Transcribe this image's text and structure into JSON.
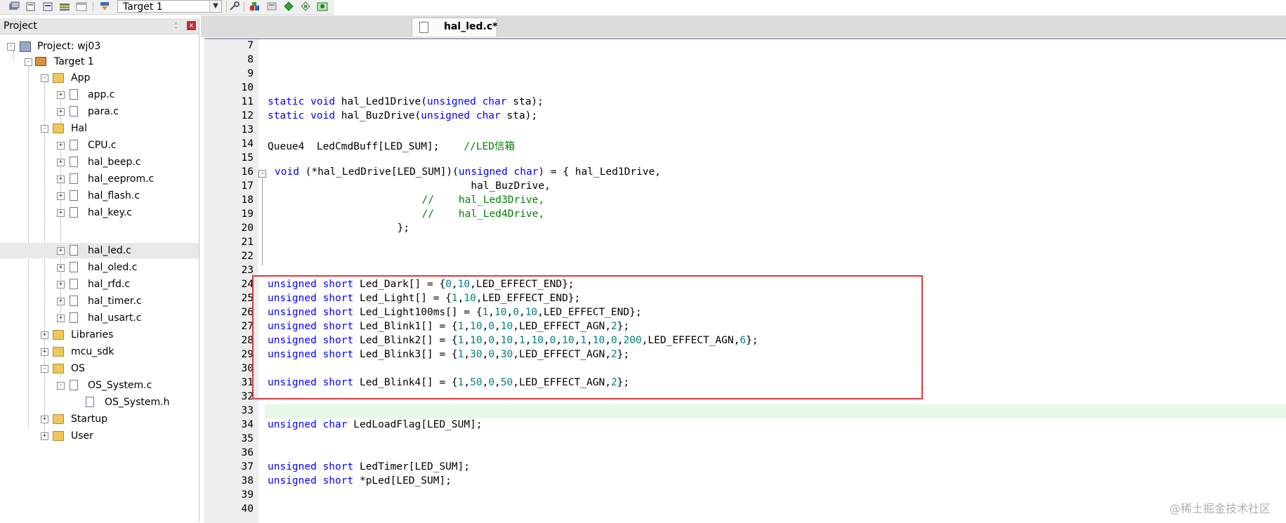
{
  "toolbar": {
    "target_select_value": "Target 1",
    "icons": [
      "batch-setup-icon",
      "copy-icon",
      "project-icon",
      "books-icon",
      "window-icon",
      "load-icon",
      "wrench-icon",
      "pack-installer-icon",
      "select-packs-icon",
      "manage-environment-icon",
      "green-diamond-icon",
      "components-icon"
    ]
  },
  "project_panel": {
    "title": "Project",
    "pin_glyph": "⍘",
    "close_glyph": "x",
    "tree": {
      "project_label": "Project: wj03",
      "target_label": "Target 1",
      "groups": {
        "app": {
          "label": "App",
          "files": [
            "app.c",
            "para.c"
          ]
        },
        "hal": {
          "label": "Hal",
          "files": [
            "CPU.c",
            "hal_beep.c",
            "hal_eeprom.c",
            "hal_flash.c",
            "hal_key.c",
            "hal_led.c",
            "hal_oled.c",
            "hal_rfd.c",
            "hal_timer.c",
            "hal_usart.c"
          ]
        },
        "libraries": {
          "label": "Libraries"
        },
        "mcu_sdk": {
          "label": "mcu_sdk"
        },
        "os": {
          "label": "OS",
          "file": "OS_System.c",
          "subfile": "OS_System.h"
        },
        "startup": {
          "label": "Startup"
        },
        "user": {
          "label": "User"
        }
      },
      "selected_file": "hal_led.c"
    }
  },
  "editor": {
    "tab_label": "hal_led.c*",
    "line_numbers": [
      "7",
      "8",
      "9",
      "10",
      "11",
      "12",
      "13",
      "14",
      "15",
      "16",
      "17",
      "18",
      "19",
      "20",
      "21",
      "22",
      "23",
      "24",
      "25",
      "26",
      "27",
      "28",
      "29",
      "30",
      "31",
      "32",
      "33",
      "34",
      "35",
      "36",
      "37",
      "38",
      "39",
      "40"
    ],
    "lines": {
      "l11": "static void hal_Led1Drive(unsigned char sta);",
      "l12": "static void hal_BuzDrive(unsigned char sta);",
      "l14_code": "Queue4  LedCmdBuff[LED_SUM];    ",
      "l14_comment": "//LED信箱",
      "l16": "void (*hal_LedDrive[LED_SUM])(unsigned char) = { hal_Led1Drive,",
      "l17": "                                hal_BuzDrive,",
      "l18": "                        //    hal_Led3Drive,",
      "l19": "                        //    hal_Led4Drive,",
      "l20": "                    };",
      "l24": "unsigned short Led_Dark[] = {0,10,LED_EFFECT_END};",
      "l25": "unsigned short Led_Light[] = {1,10,LED_EFFECT_END};",
      "l26": "unsigned short Led_Light100ms[] = {1,10,0,10,LED_EFFECT_END};",
      "l27": "unsigned short Led_Blink1[] = {1,10,0,10,LED_EFFECT_AGN,2};",
      "l28": "unsigned short Led_Blink2[] = {1,10,0,10,1,10,0,10,1,10,0,200,LED_EFFECT_AGN,6};",
      "l29": "unsigned short Led_Blink3[] = {1,30,0,30,LED_EFFECT_AGN,2};",
      "l31": "unsigned short Led_Blink4[] = {1,50,0,50,LED_EFFECT_AGN,2};",
      "l34": "unsigned char LedLoadFlag[LED_SUM];",
      "l37": "unsigned short LedTimer[LED_SUM];",
      "l38": "unsigned short *pLed[LED_SUM];"
    }
  },
  "watermark": "@稀土掘金技术社区",
  "colors": {
    "keyword": "#0000ff",
    "number": "#008080",
    "comment": "#008000",
    "highlight_box": "#e0393a",
    "current_line": "#e8f8e8",
    "gutter": "#eeeeee"
  }
}
